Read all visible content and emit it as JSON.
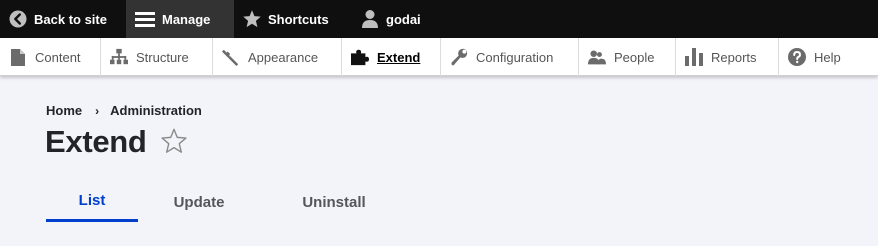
{
  "toolbar": {
    "back_to_site": "Back to site",
    "manage": "Manage",
    "shortcuts": "Shortcuts",
    "user": "godai"
  },
  "tray": {
    "items": [
      {
        "label": "Content",
        "icon": "document-icon"
      },
      {
        "label": "Structure",
        "icon": "sitemap-icon"
      },
      {
        "label": "Appearance",
        "icon": "paintbrush-icon"
      },
      {
        "label": "Extend",
        "icon": "puzzle-icon",
        "active": true
      },
      {
        "label": "Configuration",
        "icon": "wrench-icon"
      },
      {
        "label": "People",
        "icon": "people-icon"
      },
      {
        "label": "Reports",
        "icon": "bar-chart-icon"
      },
      {
        "label": "Help",
        "icon": "help-icon"
      }
    ]
  },
  "breadcrumb": {
    "home": "Home",
    "separator": "›",
    "admin": "Administration"
  },
  "page": {
    "title": "Extend"
  },
  "tabs": {
    "list": "List",
    "update": "Update",
    "uninstall": "Uninstall",
    "active": "List"
  },
  "colors": {
    "toolbar_bg": "#0f0f0f",
    "active_tab": "#003ecc",
    "page_bg": "#f3f4f9"
  }
}
